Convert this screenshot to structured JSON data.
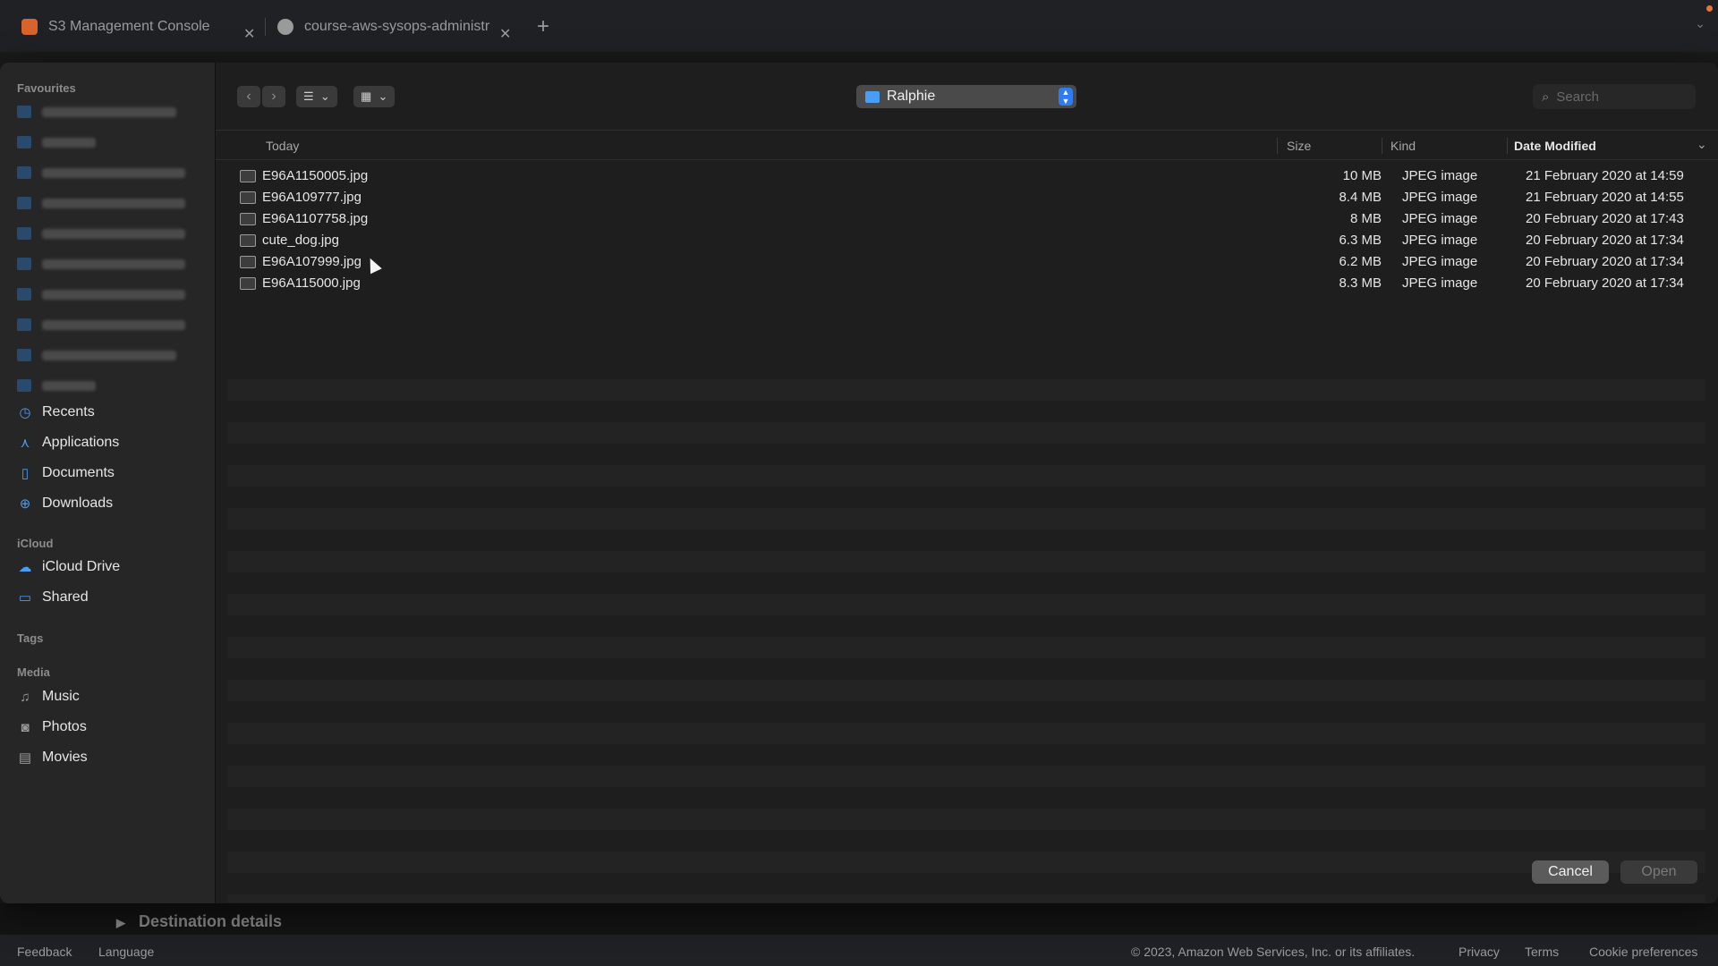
{
  "browser": {
    "tabs": [
      {
        "title": "S3 Management Console",
        "color": "#d9642b"
      },
      {
        "title": "course-aws-sysops-administr",
        "color": "#9a9a9a"
      }
    ],
    "new_tab": "+"
  },
  "underlying_page": {
    "section_title": "Destination details",
    "footer": {
      "feedback": "Feedback",
      "language": "Language",
      "copyright": "© 2023, Amazon Web Services, Inc. or its affiliates.",
      "privacy": "Privacy",
      "terms": "Terms",
      "cookies": "Cookie preferences"
    }
  },
  "dialog": {
    "sidebar": {
      "favourites_header": "Favourites",
      "favourites": [
        {
          "label": "Recents",
          "icon": "clock-icon"
        },
        {
          "label": "Applications",
          "icon": "applications-icon"
        },
        {
          "label": "Documents",
          "icon": "document-icon"
        },
        {
          "label": "Downloads",
          "icon": "download-icon"
        }
      ],
      "icloud_header": "iCloud",
      "icloud": [
        {
          "label": "iCloud Drive",
          "icon": "cloud-icon"
        },
        {
          "label": "Shared",
          "icon": "shared-folder-icon"
        }
      ],
      "tags_header": "Tags",
      "media_header": "Media",
      "media": [
        {
          "label": "Music",
          "icon": "music-icon"
        },
        {
          "label": "Photos",
          "icon": "camera-icon"
        },
        {
          "label": "Movies",
          "icon": "film-icon"
        }
      ]
    },
    "location": "Ralphie",
    "search_placeholder": "Search",
    "columns": {
      "group": "Today",
      "size": "Size",
      "kind": "Kind",
      "date": "Date Modified"
    },
    "files": [
      {
        "name": "E96A1150005.jpg",
        "size": "10 MB",
        "kind": "JPEG image",
        "date": "21 February 2020 at 14:59"
      },
      {
        "name": "E96A109777.jpg",
        "size": "8.4 MB",
        "kind": "JPEG image",
        "date": "21 February 2020 at 14:55"
      },
      {
        "name": "E96A1107758.jpg",
        "size": "8 MB",
        "kind": "JPEG image",
        "date": "20 February 2020 at 17:43"
      },
      {
        "name": "cute_dog.jpg",
        "size": "6.3 MB",
        "kind": "JPEG image",
        "date": "20 February 2020 at 17:34"
      },
      {
        "name": "E96A107999.jpg",
        "size": "6.2 MB",
        "kind": "JPEG image",
        "date": "20 February 2020 at 17:34"
      },
      {
        "name": "E96A115000.jpg",
        "size": "8.3 MB",
        "kind": "JPEG image",
        "date": "20 February 2020 at 17:34"
      }
    ],
    "buttons": {
      "cancel": "Cancel",
      "open": "Open"
    }
  }
}
